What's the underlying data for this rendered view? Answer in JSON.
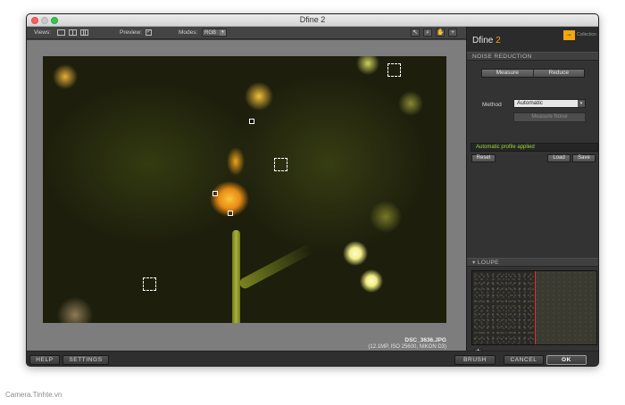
{
  "window": {
    "title": "Dfine 2"
  },
  "toolbar": {
    "views_label": "Views:",
    "view_buttons": [
      "single-view-icon",
      "split-view-icon",
      "side-by-side-view-icon"
    ],
    "preview_label": "Preview:",
    "preview_checked": true,
    "modes_label": "Modes:",
    "mode_value": "RGB",
    "tools": [
      "pointer-tool-icon",
      "zoom-tool-icon",
      "hand-tool-icon",
      "add-point-tool-icon"
    ]
  },
  "image": {
    "file_name": "DSC_3636.JPG",
    "file_info": "(12.1MP, ISO 25600, NIKON D3)"
  },
  "panel": {
    "app_name": "Dfine",
    "app_version": "2",
    "logo_text": "Collection",
    "noise_reduction_title": "NOISE REDUCTION",
    "measure_label": "Measure",
    "reduce_label": "Reduce",
    "method_label": "Method",
    "method_value": "Automatic",
    "measure_noise_label": "Measure Noise",
    "status": "Automatic profile applied",
    "reset_label": "Reset",
    "load_label": "Load",
    "save_label": "Save",
    "loupe_title": "LOUPE"
  },
  "bottom": {
    "help": "HELP",
    "settings": "SETTINGS",
    "brush": "BRUSH",
    "cancel": "CANCEL",
    "ok": "OK"
  },
  "watermark": "Camera.Tinhte.vn",
  "colors": {
    "accent": "#f2a60f",
    "status_green": "#9ed832",
    "loupe_divider": "#e13030"
  }
}
